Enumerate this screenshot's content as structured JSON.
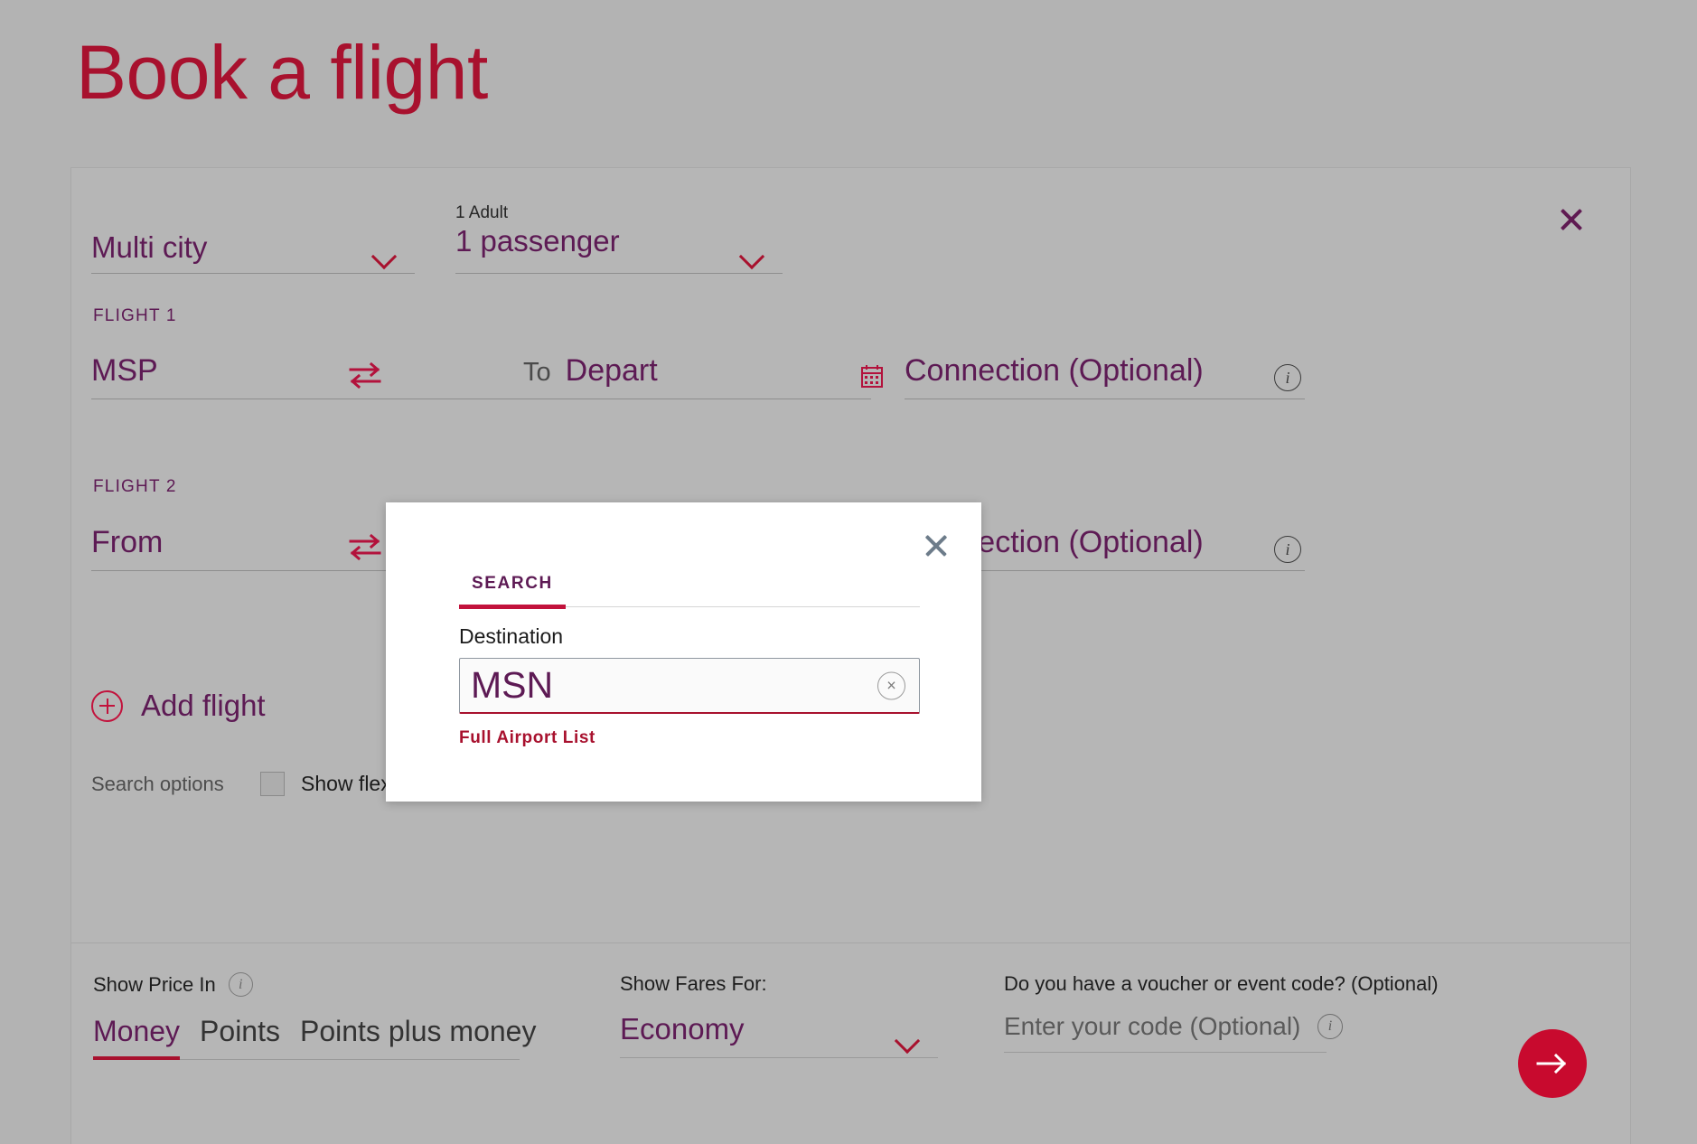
{
  "page": {
    "title": "Book a flight",
    "brand_red": "#a8112e",
    "brand_purple": "#5d1a54",
    "background": "#b3b3b3"
  },
  "booking": {
    "close_icon": "close-icon",
    "trip_type": {
      "value": "Multi city",
      "chevron": "chevron-down-icon"
    },
    "passengers": {
      "mini_label": "1 Adult",
      "value": "1 passenger",
      "chevron": "chevron-down-icon"
    },
    "flights": [
      {
        "label": "FLIGHT 1",
        "origin": "MSP",
        "swap_icon": "swap-arrows-icon",
        "to_label": "To",
        "destination": "Depart",
        "calendar_icon": "calendar-icon",
        "connection": "Connection (Optional)",
        "info_icon": "info-icon"
      },
      {
        "label": "FLIGHT 2",
        "origin": "From",
        "swap_icon": "swap-arrows-icon",
        "to_label": "",
        "destination": "",
        "calendar_icon": "calendar-icon",
        "connection": "Connection (Optional)",
        "info_icon": "info-icon"
      }
    ],
    "add_flight": {
      "icon": "plus-circle-icon",
      "label": "Add flight"
    },
    "search_options": {
      "label": "Search options",
      "checkbox_name": "show-flexible-tickets-checkbox",
      "checkbox_label": "Show flexible tickets",
      "checked": false,
      "info_icon": "info-icon"
    }
  },
  "bottom": {
    "show_price_in": {
      "label": "Show Price In",
      "info_icon": "info-icon",
      "tabs": [
        "Money",
        "Points",
        "Points plus money"
      ],
      "active": "Money"
    },
    "show_fares_for": {
      "label": "Show Fares For:",
      "value": "Economy",
      "chevron": "chevron-down-icon"
    },
    "voucher": {
      "label": "Do you have a voucher or event code? (Optional)",
      "placeholder": "Enter your code (Optional)",
      "value": "",
      "info_icon": "info-icon"
    },
    "submit": {
      "icon": "arrow-right-icon",
      "color": "#c80a2e"
    }
  },
  "modal": {
    "close_icon": "close-icon",
    "tabs": [
      {
        "label": "SEARCH",
        "active": true
      }
    ],
    "field_label": "Destination",
    "input_value": "MSN",
    "clear_icon": "clear-icon",
    "link_label": "Full Airport List"
  }
}
